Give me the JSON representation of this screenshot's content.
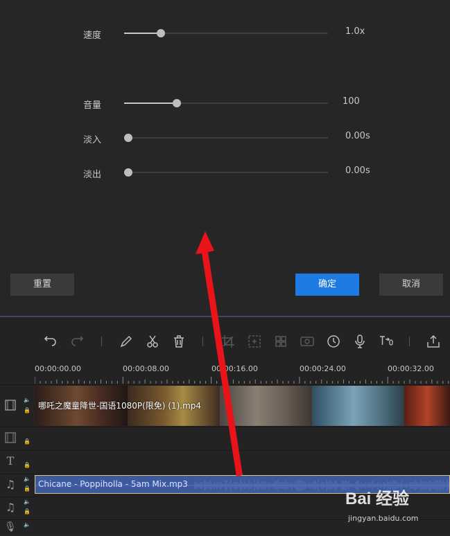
{
  "sliders": {
    "speed": {
      "label": "速度",
      "value": "1.0x",
      "level": 0.18
    },
    "volume": {
      "label": "音量",
      "value": "100",
      "level": 0.26
    },
    "fade_in": {
      "label": "淡入",
      "value": "0.00s",
      "level": 0.02
    },
    "fade_out": {
      "label": "淡出",
      "value": "0.00s",
      "level": 0.02
    }
  },
  "buttons": {
    "reset": "重置",
    "confirm": "确定",
    "cancel": "取消"
  },
  "toolbar": {
    "icons": [
      "undo-icon",
      "redo-icon",
      "edit-icon",
      "cut-icon",
      "delete-icon",
      "crop-icon",
      "zoom-icon",
      "mosaic-icon",
      "record-icon",
      "speed-icon",
      "voice-icon",
      "text-to-speech-icon",
      "export-icon"
    ]
  },
  "ruler": {
    "timecodes": [
      "00:00:00.00",
      "00:00:08.00",
      "00:00:16.00",
      "00:00:24.00",
      "00:00:32.00"
    ]
  },
  "tracks": {
    "video_clip_name": "哪吒之魔童降世-国语1080P(限免) (1).mp4",
    "audio_clip_name": "Chicane - Poppiholla - 5am Mix.mp3"
  },
  "watermark": {
    "logo": "Bai 经验",
    "url": "jingyan.baidu.com"
  },
  "colors": {
    "accent": "#1e7be4",
    "audio_clip": "#3d5a9e",
    "arrow": "#e8141a"
  }
}
